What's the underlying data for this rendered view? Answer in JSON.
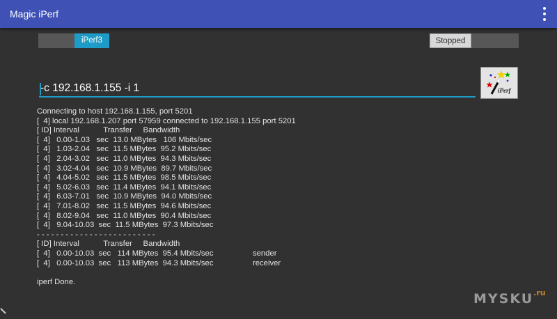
{
  "appbar": {
    "title": "Magic iPerf"
  },
  "mode_toggle": {
    "selected_label": "iPerf3"
  },
  "run_toggle": {
    "state_label": "Stopped"
  },
  "command": {
    "value": "-c 192.168.1.155 -i 1"
  },
  "run_button": {
    "logo_text": "iPerf"
  },
  "log": {
    "connecting": "Connecting to host 192.168.1.155, port 5201",
    "local": "[  4] local 192.168.1.207 port 57959 connected to 192.168.1.155 port 5201",
    "header": "[ ID] Interval           Transfer     Bandwidth",
    "intervals": [
      "[  4]   0.00-1.03   sec  13.0 MBytes   106 Mbits/sec",
      "[  4]   1.03-2.04   sec  11.5 MBytes  95.2 Mbits/sec",
      "[  4]   2.04-3.02   sec  11.0 MBytes  94.3 Mbits/sec",
      "[  4]   3.02-4.04   sec  10.9 MBytes  89.7 Mbits/sec",
      "[  4]   4.04-5.02   sec  11.5 MBytes  98.5 Mbits/sec",
      "[  4]   5.02-6.03   sec  11.4 MBytes  94.1 Mbits/sec",
      "[  4]   6.03-7.01   sec  10.9 MBytes  94.0 Mbits/sec",
      "[  4]   7.01-8.02   sec  11.5 MBytes  94.6 Mbits/sec",
      "[  4]   8.02-9.04   sec  11.0 MBytes  90.4 Mbits/sec",
      "[  4]   9.04-10.03  sec  11.5 MBytes  97.3 Mbits/sec"
    ],
    "separator": "- - - - - - - - - - - - - - - - - - - - - - - - -",
    "summary_header": "[ ID] Interval           Transfer     Bandwidth",
    "summary": [
      "[  4]   0.00-10.03  sec   114 MBytes  95.4 Mbits/sec                  sender",
      "[  4]   0.00-10.03  sec   113 MBytes  94.3 Mbits/sec                  receiver"
    ],
    "done": "iperf Done."
  },
  "watermark": {
    "text": "MYSKU",
    "suffix": ".ru"
  }
}
